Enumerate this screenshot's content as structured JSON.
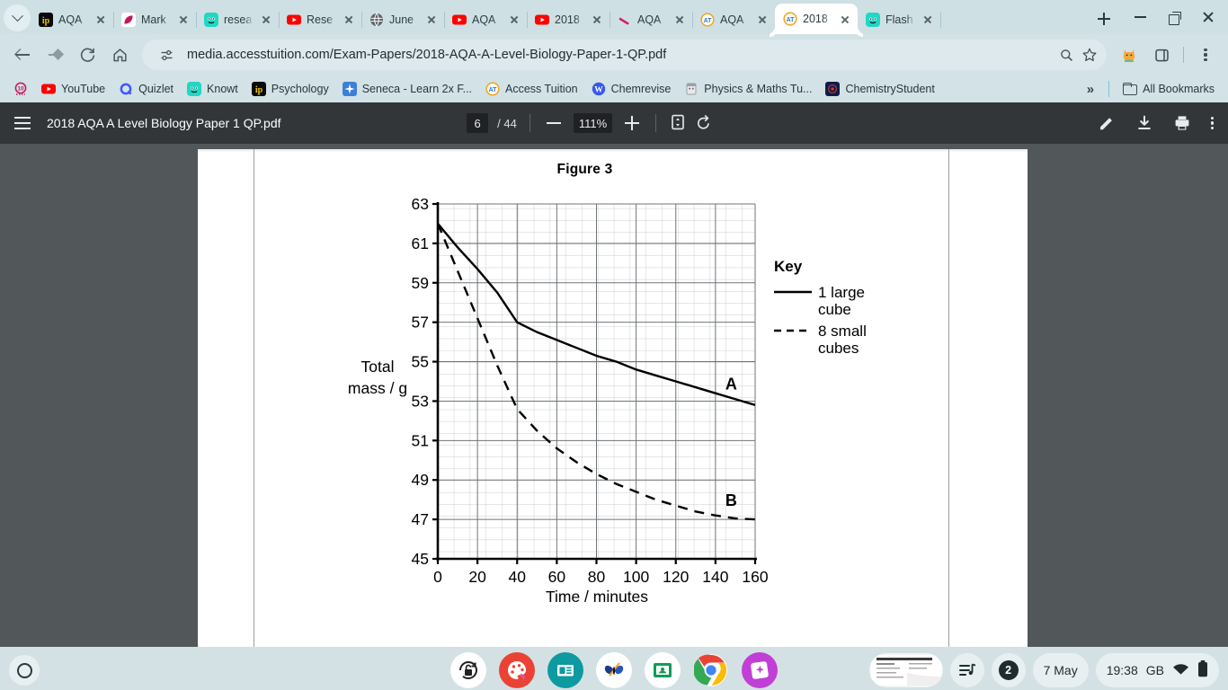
{
  "browser": {
    "tabs": [
      {
        "label": "AQA",
        "icon": "ip-icon",
        "active": false
      },
      {
        "label": "Mark",
        "icon": "seneca-icon",
        "active": false
      },
      {
        "label": "resea",
        "icon": "knowt-icon",
        "active": false
      },
      {
        "label": "Rese",
        "icon": "youtube-icon",
        "active": false
      },
      {
        "label": "June",
        "icon": "globe-icon",
        "active": false
      },
      {
        "label": "AQA",
        "icon": "youtube-icon",
        "active": false
      },
      {
        "label": "2018",
        "icon": "youtube-icon",
        "active": false
      },
      {
        "label": "AQA",
        "icon": "swoosh-icon",
        "active": false
      },
      {
        "label": "AQA",
        "icon": "access-tuition-icon",
        "active": false
      },
      {
        "label": "2018",
        "icon": "access-tuition-icon",
        "active": true
      },
      {
        "label": "Flash",
        "icon": "knowt-icon",
        "active": false
      }
    ],
    "new_tab_label": "+",
    "url": "media.accesstuition.com/Exam-Papers/2018-AQA-A-Level-Biology-Paper-1-QP.pdf",
    "bookmarks": [
      {
        "label": "",
        "icon": "ten-icon"
      },
      {
        "label": "YouTube",
        "icon": "youtube-icon"
      },
      {
        "label": "Quizlet",
        "icon": "quizlet-icon"
      },
      {
        "label": "Knowt",
        "icon": "knowt-icon"
      },
      {
        "label": "Psychology",
        "icon": "ip-icon"
      },
      {
        "label": "Seneca - Learn 2x F...",
        "icon": "seneca-star-icon"
      },
      {
        "label": "Access Tuition",
        "icon": "access-tuition-icon"
      },
      {
        "label": "Chemrevise",
        "icon": "wordpress-icon"
      },
      {
        "label": "Physics & Maths Tu...",
        "icon": "pmt-icon"
      },
      {
        "label": "ChemistryStudent",
        "icon": "chemistrystudent-icon"
      }
    ],
    "overflow_label": "»",
    "all_bookmarks_label": "All Bookmarks"
  },
  "pdf": {
    "title": "2018 AQA A Level Biology Paper 1 QP.pdf",
    "page_current": "6",
    "page_total": "/ 44",
    "zoom": "111%",
    "icons": {
      "menu": "hamburger-icon",
      "zoom_out": "minus-icon",
      "zoom_in": "plus-icon",
      "fit": "fit-page-icon",
      "rotate": "rotate-icon",
      "annotate": "pencil-icon",
      "download": "download-icon",
      "print": "print-icon",
      "more": "kebab-icon"
    }
  },
  "chart_data": {
    "type": "line",
    "title": "Figure 3",
    "xlabel": "Time / minutes",
    "ylabel": "Total\nmass / g",
    "ylabel_line1": "Total",
    "ylabel_line2": "mass / g",
    "xlim": [
      0,
      160
    ],
    "ylim": [
      45,
      63
    ],
    "xticks": [
      0,
      20,
      40,
      60,
      80,
      100,
      120,
      140,
      160
    ],
    "yticks": [
      45,
      47,
      49,
      51,
      53,
      55,
      57,
      59,
      61,
      63
    ],
    "grid": "major and minor gridlines",
    "legend_title": "Key",
    "series": [
      {
        "name": "1 large cube",
        "label_on_plot": "A",
        "style": "solid",
        "x": [
          0,
          10,
          20,
          30,
          40,
          50,
          60,
          70,
          80,
          90,
          100,
          110,
          120,
          130,
          140,
          150,
          160
        ],
        "y": [
          62.0,
          60.8,
          59.7,
          58.5,
          57.0,
          56.5,
          56.1,
          55.7,
          55.3,
          55.0,
          54.6,
          54.3,
          54.0,
          53.7,
          53.4,
          53.1,
          52.8
        ]
      },
      {
        "name": "8 small cubes",
        "label_on_plot": "B",
        "style": "dashed",
        "x": [
          0,
          10,
          20,
          30,
          40,
          50,
          60,
          70,
          80,
          90,
          100,
          110,
          120,
          130,
          140,
          150,
          160
        ],
        "y": [
          62.0,
          59.6,
          57.2,
          54.8,
          52.6,
          51.5,
          50.6,
          49.9,
          49.3,
          48.8,
          48.4,
          48.0,
          47.7,
          47.4,
          47.2,
          47.05,
          47.0
        ]
      }
    ],
    "legend": [
      {
        "label_line1": "1 large",
        "label_line2": "cube",
        "style": "solid"
      },
      {
        "label_line1": "8 small",
        "label_line2": "cubes",
        "style": "dashed"
      }
    ]
  },
  "shelf": {
    "launcher": "launcher-icon",
    "apps": [
      {
        "name": "lock-rotation-icon"
      },
      {
        "name": "paint-icon"
      },
      {
        "name": "news-icon"
      },
      {
        "name": "butterfly-icon"
      },
      {
        "name": "google-classroom-icon"
      },
      {
        "name": "chrome-icon"
      },
      {
        "name": "gemini-icon"
      }
    ],
    "window_thumbnail": "document-thumbnail",
    "media_icon": "media-controls-icon",
    "notification_count": "2",
    "date": "7 May",
    "time": "19:38",
    "locale": "GB",
    "wifi_icon": "wifi-icon",
    "battery_icon": "battery-icon"
  }
}
